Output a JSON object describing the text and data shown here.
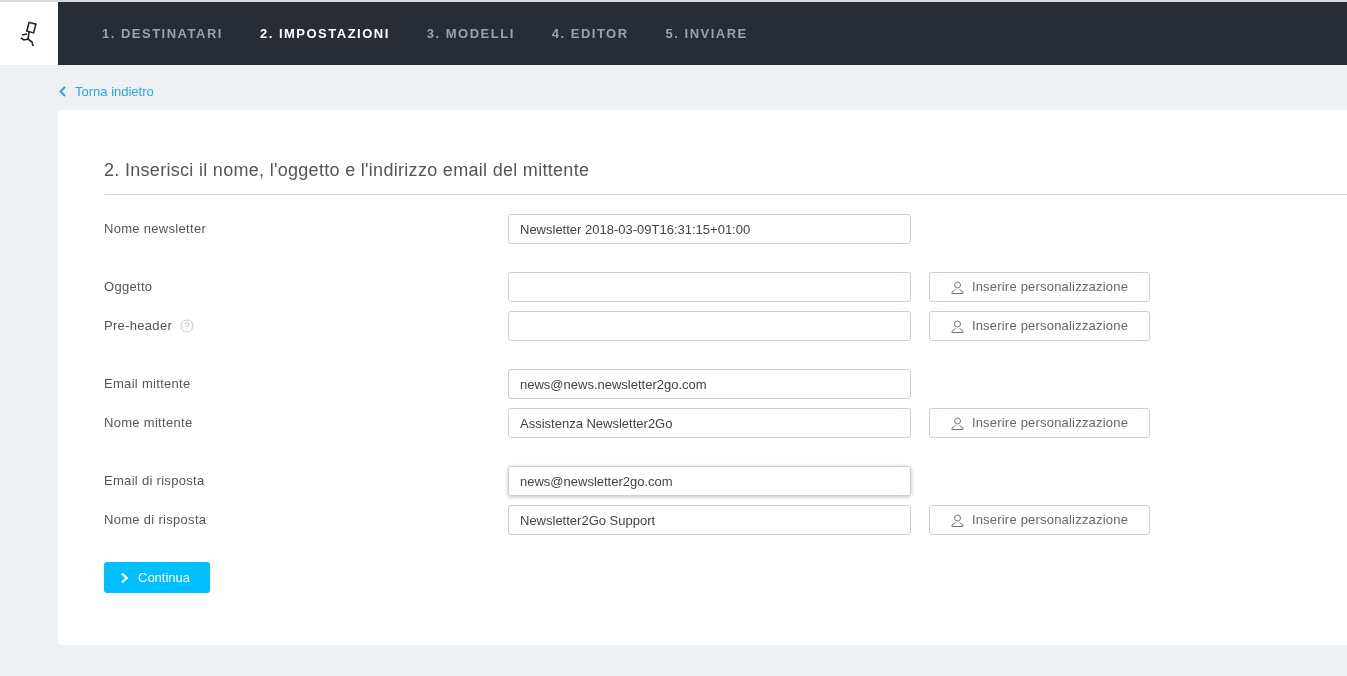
{
  "steps": [
    {
      "label": "1. DESTINATARI",
      "selected": false
    },
    {
      "label": "2. IMPOSTAZIONI",
      "selected": true
    },
    {
      "label": "3. MODELLI",
      "selected": false
    },
    {
      "label": "4. EDITOR",
      "selected": false
    },
    {
      "label": "5. INVIARE",
      "selected": false
    }
  ],
  "back_link": "Torna indietro",
  "heading": "2. Inserisci il nome, l'oggetto e l'indirizzo email del mittente",
  "groups": [
    [
      {
        "label": "Nome newsletter",
        "value": "Newsletter 2018-03-09T16:31:15+01:00",
        "help": false,
        "focused": false
      }
    ],
    [
      {
        "label": "Oggetto",
        "help": false,
        "focused": false,
        "button": "Inserire personalizzazione"
      },
      {
        "label": "Pre-header",
        "help": true,
        "focused": false,
        "button": "Inserire personalizzazione"
      }
    ],
    [
      {
        "label": "Email mittente",
        "value": "news@news.newsletter2go.com",
        "help": false,
        "focused": false
      },
      {
        "label": "Nome mittente",
        "value": "Assistenza Newsletter2Go",
        "help": false,
        "focused": false,
        "button": "Inserire personalizzazione"
      }
    ],
    [
      {
        "label": "Email di risposta",
        "value": "news@newsletter2go.com",
        "help": false,
        "focused": true
      },
      {
        "label": "Nome di risposta",
        "value": "Newsletter2Go Support",
        "help": false,
        "focused": false,
        "button": "Inserire personalizzazione"
      }
    ]
  ],
  "continue_button": "Continua"
}
